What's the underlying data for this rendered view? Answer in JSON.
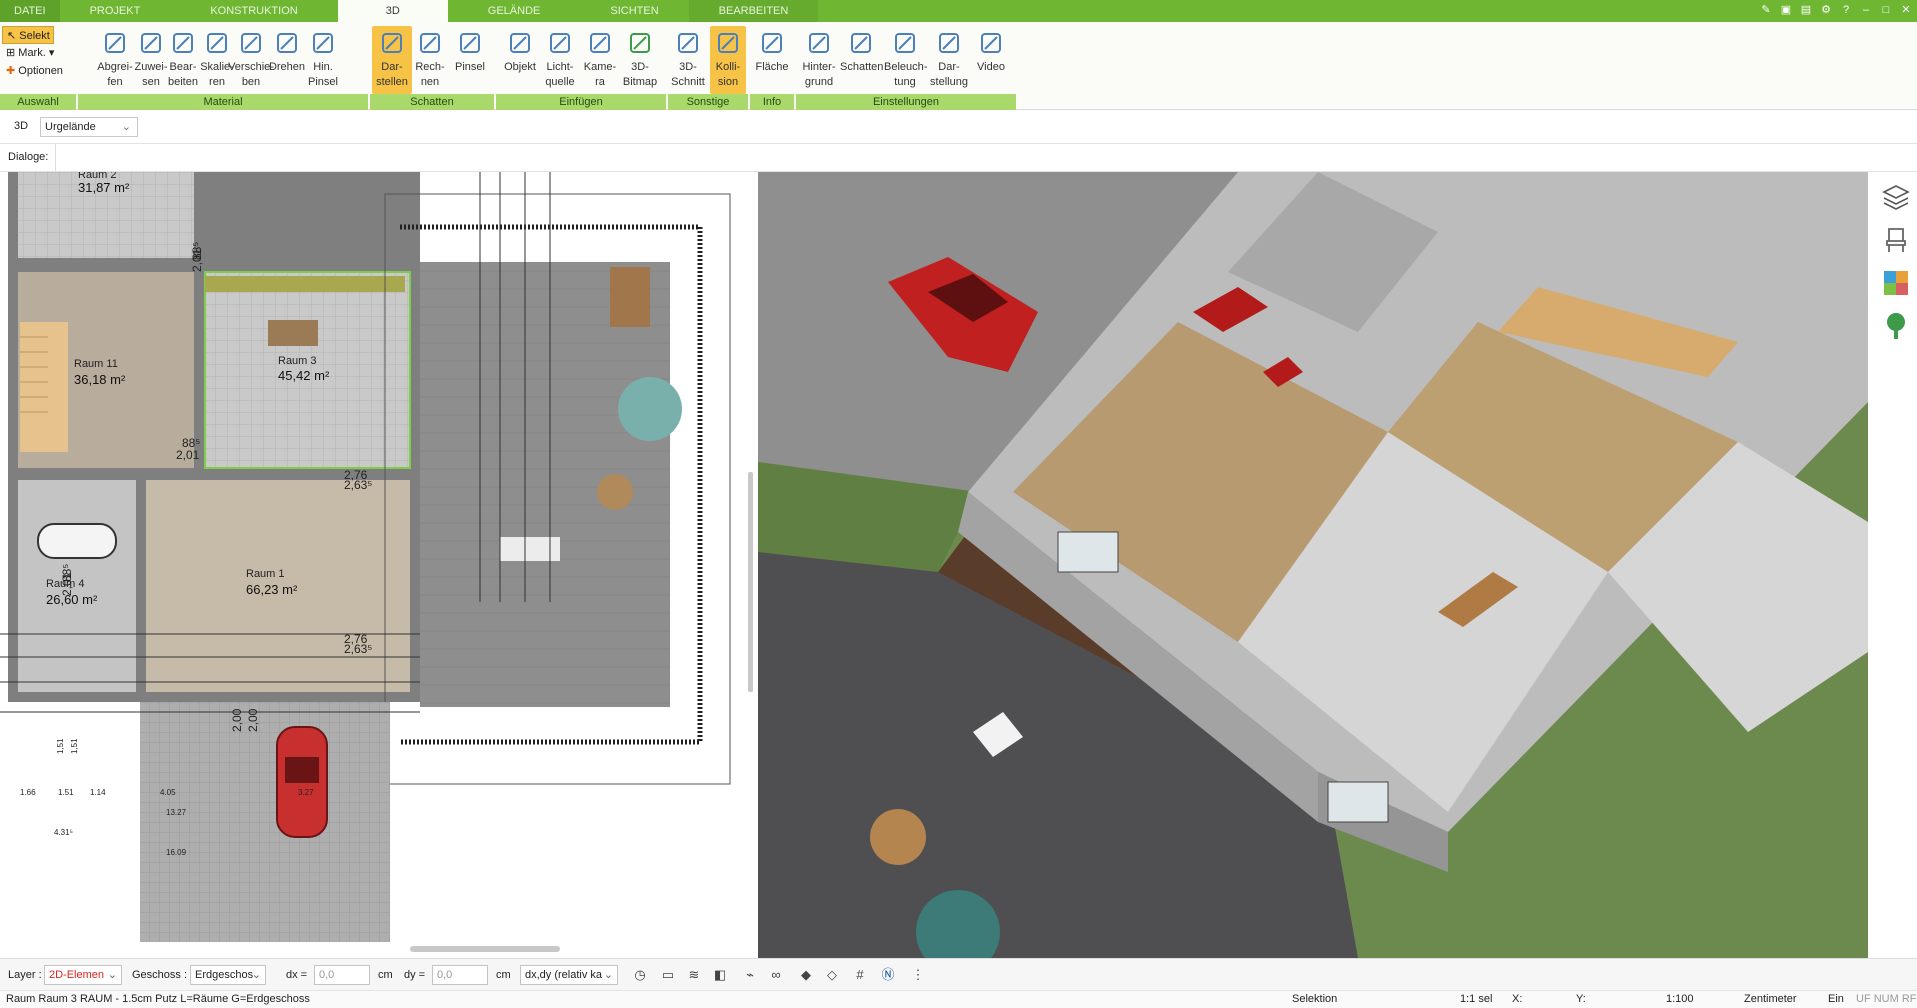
{
  "tabs": [
    "DATEI",
    "PROJEKT",
    "KONSTRUKTION",
    "3D",
    "GELÄNDE",
    "SICHTEN",
    "BEARBEITEN"
  ],
  "active_tab": "3D",
  "ribbon": {
    "auswahl": {
      "selekt": "Selekt",
      "mark": "Mark.",
      "optionen": "Optionen",
      "label": "Auswahl"
    },
    "material": {
      "label": "Material",
      "buttons": [
        [
          "Abgrei-",
          "fen"
        ],
        [
          "Zuwei-",
          "sen"
        ],
        [
          "Bear-",
          "beiten"
        ],
        [
          "Skalie-",
          "ren"
        ],
        [
          "Verschie-",
          "ben"
        ],
        [
          "Drehen",
          ""
        ],
        [
          "Hin.",
          "Pinsel"
        ]
      ]
    },
    "schatten": {
      "label": "Schatten",
      "buttons": [
        [
          "Dar-",
          "stellen"
        ],
        [
          "Rech-",
          "nen"
        ],
        [
          "Pinsel",
          ""
        ]
      ]
    },
    "einfuegen": {
      "label": "Einfügen",
      "buttons": [
        [
          "Objekt",
          ""
        ],
        [
          "Licht-",
          "quelle"
        ],
        [
          "Kame-",
          "ra"
        ],
        [
          "3D-",
          "Bitmap"
        ]
      ]
    },
    "sonstige": {
      "label": "Sonstige",
      "buttons": [
        [
          "3D-",
          "Schnitt"
        ],
        [
          "Kolli-",
          "sion"
        ]
      ]
    },
    "info": {
      "label": "Info",
      "buttons": [
        [
          "Fläche",
          ""
        ]
      ]
    },
    "einstellungen": {
      "label": "Einstellungen",
      "buttons": [
        [
          "Hinter-",
          "grund"
        ],
        [
          "Schatten",
          ""
        ],
        [
          "Beleuch-",
          "tung"
        ],
        [
          "Dar-",
          "stellung"
        ],
        [
          "Video",
          ""
        ]
      ]
    }
  },
  "toolbar2": {
    "mode": "3D",
    "terrain": "Urgelände"
  },
  "dialoge_label": "Dialoge:",
  "rooms": [
    {
      "name": "Raum 2",
      "area": "31,87 m²"
    },
    {
      "name": "Raum 11",
      "area": "36,18 m²"
    },
    {
      "name": "Raum 3",
      "area": "45,42 m²"
    },
    {
      "name": "Raum 4",
      "area": "26,60 m²"
    },
    {
      "name": "Raum 1",
      "area": "66,23 m²"
    }
  ],
  "dimensions": [
    "88⁵",
    "2,01",
    "88⁵",
    "2,01",
    "2,76",
    "2,63⁵",
    "2,76",
    "2,63⁵",
    "88⁵",
    "2,01",
    "2,00",
    "2,00",
    "1,51",
    "1,51",
    "1.66",
    "1.51",
    "1.14",
    "4.05",
    "3.27",
    "13.27",
    "4.31⁵",
    "16.09"
  ],
  "statusbar": {
    "layer_label": "Layer :",
    "layer_value": "2D-Elemen",
    "geschoss_label": "Geschoss :",
    "geschoss_value": "Erdgeschos",
    "dx_label": "dx =",
    "dx_value": "0,0",
    "dy_label": "dy =",
    "dy_value": "0,0",
    "unit": "cm",
    "rel": "dx,dy (relativ ka"
  },
  "infobar": {
    "selection": "Raum Raum 3 RAUM - 1.5cm Putz L=Räume G=Erdgeschoss",
    "mode": "Selektion",
    "sel": "1:1 sel",
    "x": "X:",
    "y": "Y:",
    "scale": "1:100",
    "unit": "Zentimeter",
    "ein": "Ein",
    "flags": "UF NUM RF"
  },
  "colors": {
    "tabbar": "#6fb732",
    "ribbon_label": "#a9d86b",
    "selected": "#f6c346",
    "grass": "#6d8a4e"
  }
}
